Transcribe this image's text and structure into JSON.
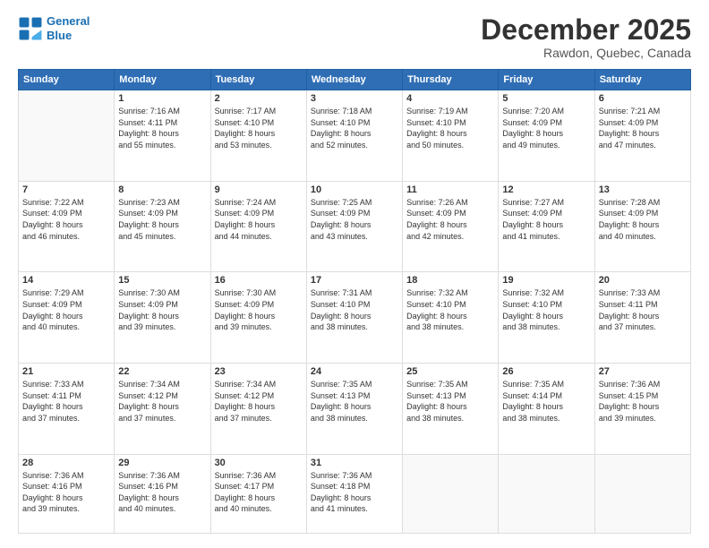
{
  "header": {
    "logo_line1": "General",
    "logo_line2": "Blue",
    "month": "December 2025",
    "location": "Rawdon, Quebec, Canada"
  },
  "weekdays": [
    "Sunday",
    "Monday",
    "Tuesday",
    "Wednesday",
    "Thursday",
    "Friday",
    "Saturday"
  ],
  "weeks": [
    [
      {
        "day": "",
        "info": ""
      },
      {
        "day": "1",
        "info": "Sunrise: 7:16 AM\nSunset: 4:11 PM\nDaylight: 8 hours\nand 55 minutes."
      },
      {
        "day": "2",
        "info": "Sunrise: 7:17 AM\nSunset: 4:10 PM\nDaylight: 8 hours\nand 53 minutes."
      },
      {
        "day": "3",
        "info": "Sunrise: 7:18 AM\nSunset: 4:10 PM\nDaylight: 8 hours\nand 52 minutes."
      },
      {
        "day": "4",
        "info": "Sunrise: 7:19 AM\nSunset: 4:10 PM\nDaylight: 8 hours\nand 50 minutes."
      },
      {
        "day": "5",
        "info": "Sunrise: 7:20 AM\nSunset: 4:09 PM\nDaylight: 8 hours\nand 49 minutes."
      },
      {
        "day": "6",
        "info": "Sunrise: 7:21 AM\nSunset: 4:09 PM\nDaylight: 8 hours\nand 47 minutes."
      }
    ],
    [
      {
        "day": "7",
        "info": "Sunrise: 7:22 AM\nSunset: 4:09 PM\nDaylight: 8 hours\nand 46 minutes."
      },
      {
        "day": "8",
        "info": "Sunrise: 7:23 AM\nSunset: 4:09 PM\nDaylight: 8 hours\nand 45 minutes."
      },
      {
        "day": "9",
        "info": "Sunrise: 7:24 AM\nSunset: 4:09 PM\nDaylight: 8 hours\nand 44 minutes."
      },
      {
        "day": "10",
        "info": "Sunrise: 7:25 AM\nSunset: 4:09 PM\nDaylight: 8 hours\nand 43 minutes."
      },
      {
        "day": "11",
        "info": "Sunrise: 7:26 AM\nSunset: 4:09 PM\nDaylight: 8 hours\nand 42 minutes."
      },
      {
        "day": "12",
        "info": "Sunrise: 7:27 AM\nSunset: 4:09 PM\nDaylight: 8 hours\nand 41 minutes."
      },
      {
        "day": "13",
        "info": "Sunrise: 7:28 AM\nSunset: 4:09 PM\nDaylight: 8 hours\nand 40 minutes."
      }
    ],
    [
      {
        "day": "14",
        "info": "Sunrise: 7:29 AM\nSunset: 4:09 PM\nDaylight: 8 hours\nand 40 minutes."
      },
      {
        "day": "15",
        "info": "Sunrise: 7:30 AM\nSunset: 4:09 PM\nDaylight: 8 hours\nand 39 minutes."
      },
      {
        "day": "16",
        "info": "Sunrise: 7:30 AM\nSunset: 4:09 PM\nDaylight: 8 hours\nand 39 minutes."
      },
      {
        "day": "17",
        "info": "Sunrise: 7:31 AM\nSunset: 4:10 PM\nDaylight: 8 hours\nand 38 minutes."
      },
      {
        "day": "18",
        "info": "Sunrise: 7:32 AM\nSunset: 4:10 PM\nDaylight: 8 hours\nand 38 minutes."
      },
      {
        "day": "19",
        "info": "Sunrise: 7:32 AM\nSunset: 4:10 PM\nDaylight: 8 hours\nand 38 minutes."
      },
      {
        "day": "20",
        "info": "Sunrise: 7:33 AM\nSunset: 4:11 PM\nDaylight: 8 hours\nand 37 minutes."
      }
    ],
    [
      {
        "day": "21",
        "info": "Sunrise: 7:33 AM\nSunset: 4:11 PM\nDaylight: 8 hours\nand 37 minutes."
      },
      {
        "day": "22",
        "info": "Sunrise: 7:34 AM\nSunset: 4:12 PM\nDaylight: 8 hours\nand 37 minutes."
      },
      {
        "day": "23",
        "info": "Sunrise: 7:34 AM\nSunset: 4:12 PM\nDaylight: 8 hours\nand 37 minutes."
      },
      {
        "day": "24",
        "info": "Sunrise: 7:35 AM\nSunset: 4:13 PM\nDaylight: 8 hours\nand 38 minutes."
      },
      {
        "day": "25",
        "info": "Sunrise: 7:35 AM\nSunset: 4:13 PM\nDaylight: 8 hours\nand 38 minutes."
      },
      {
        "day": "26",
        "info": "Sunrise: 7:35 AM\nSunset: 4:14 PM\nDaylight: 8 hours\nand 38 minutes."
      },
      {
        "day": "27",
        "info": "Sunrise: 7:36 AM\nSunset: 4:15 PM\nDaylight: 8 hours\nand 39 minutes."
      }
    ],
    [
      {
        "day": "28",
        "info": "Sunrise: 7:36 AM\nSunset: 4:16 PM\nDaylight: 8 hours\nand 39 minutes."
      },
      {
        "day": "29",
        "info": "Sunrise: 7:36 AM\nSunset: 4:16 PM\nDaylight: 8 hours\nand 40 minutes."
      },
      {
        "day": "30",
        "info": "Sunrise: 7:36 AM\nSunset: 4:17 PM\nDaylight: 8 hours\nand 40 minutes."
      },
      {
        "day": "31",
        "info": "Sunrise: 7:36 AM\nSunset: 4:18 PM\nDaylight: 8 hours\nand 41 minutes."
      },
      {
        "day": "",
        "info": ""
      },
      {
        "day": "",
        "info": ""
      },
      {
        "day": "",
        "info": ""
      }
    ]
  ]
}
